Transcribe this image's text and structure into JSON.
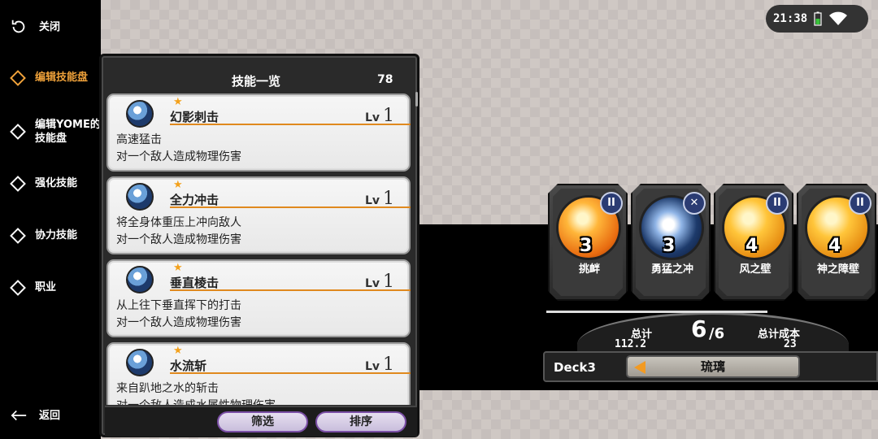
{
  "sidebar": {
    "close_label": "关闭",
    "items": [
      {
        "label": "编辑技能盘",
        "active": true
      },
      {
        "label": "编辑YOME的\n技能盘",
        "active": false
      },
      {
        "label": "强化技能",
        "active": false
      },
      {
        "label": "协力技能",
        "active": false
      },
      {
        "label": "职业",
        "active": false
      }
    ],
    "back_label": "返回"
  },
  "status_bar": {
    "time": "21:38",
    "icons": [
      "battery-icon",
      "wifi-icon"
    ]
  },
  "skill_panel": {
    "title": "技能一览",
    "count": "78",
    "skills": [
      {
        "name": "幻影刺击",
        "lv_label": "Lv",
        "lv": "1",
        "desc1": "高速猛击",
        "desc2": "对一个敌人造成物理伤害"
      },
      {
        "name": "全力冲击",
        "lv_label": "Lv",
        "lv": "1",
        "desc1": "将全身体重压上冲向敌人",
        "desc2": "对一个敌人造成物理伤害"
      },
      {
        "name": "垂直棱击",
        "lv_label": "Lv",
        "lv": "1",
        "desc1": "从上往下垂直挥下的打击",
        "desc2": "对一个敌人造成物理伤害"
      },
      {
        "name": "水流斩",
        "lv_label": "Lv",
        "lv": "1",
        "desc1": "来自趴地之水的斩击",
        "desc2": "对一个敌人造成水属性物理伤害"
      }
    ],
    "filter_label": "筛选",
    "sort_label": "排序"
  },
  "deck": {
    "cards": [
      {
        "name": "挑衅",
        "cost": "3",
        "color": "#f08a1c",
        "icon": "crosshair-icon"
      },
      {
        "name": "勇猛之冲",
        "cost": "3",
        "color": "#1d3a6b",
        "icon": "dash-icon"
      },
      {
        "name": "风之壁",
        "cost": "4",
        "color": "#f2a81e",
        "icon": "hexagon-shield-icon"
      },
      {
        "name": "神之障壁",
        "cost": "4",
        "color": "#f2a81e",
        "icon": "heart-shield-icon"
      }
    ],
    "total_label": "总计",
    "total_value": "112.2",
    "slots_used": "6",
    "slots_max": "/6",
    "total_cost_label": "总计成本",
    "total_cost_value": "23",
    "deck_name": "Deck3",
    "selected_character": "琉璃"
  },
  "colors": {
    "accent": "#f0a23a",
    "underline": "#e0891e",
    "button_border": "#7b4fa6"
  }
}
